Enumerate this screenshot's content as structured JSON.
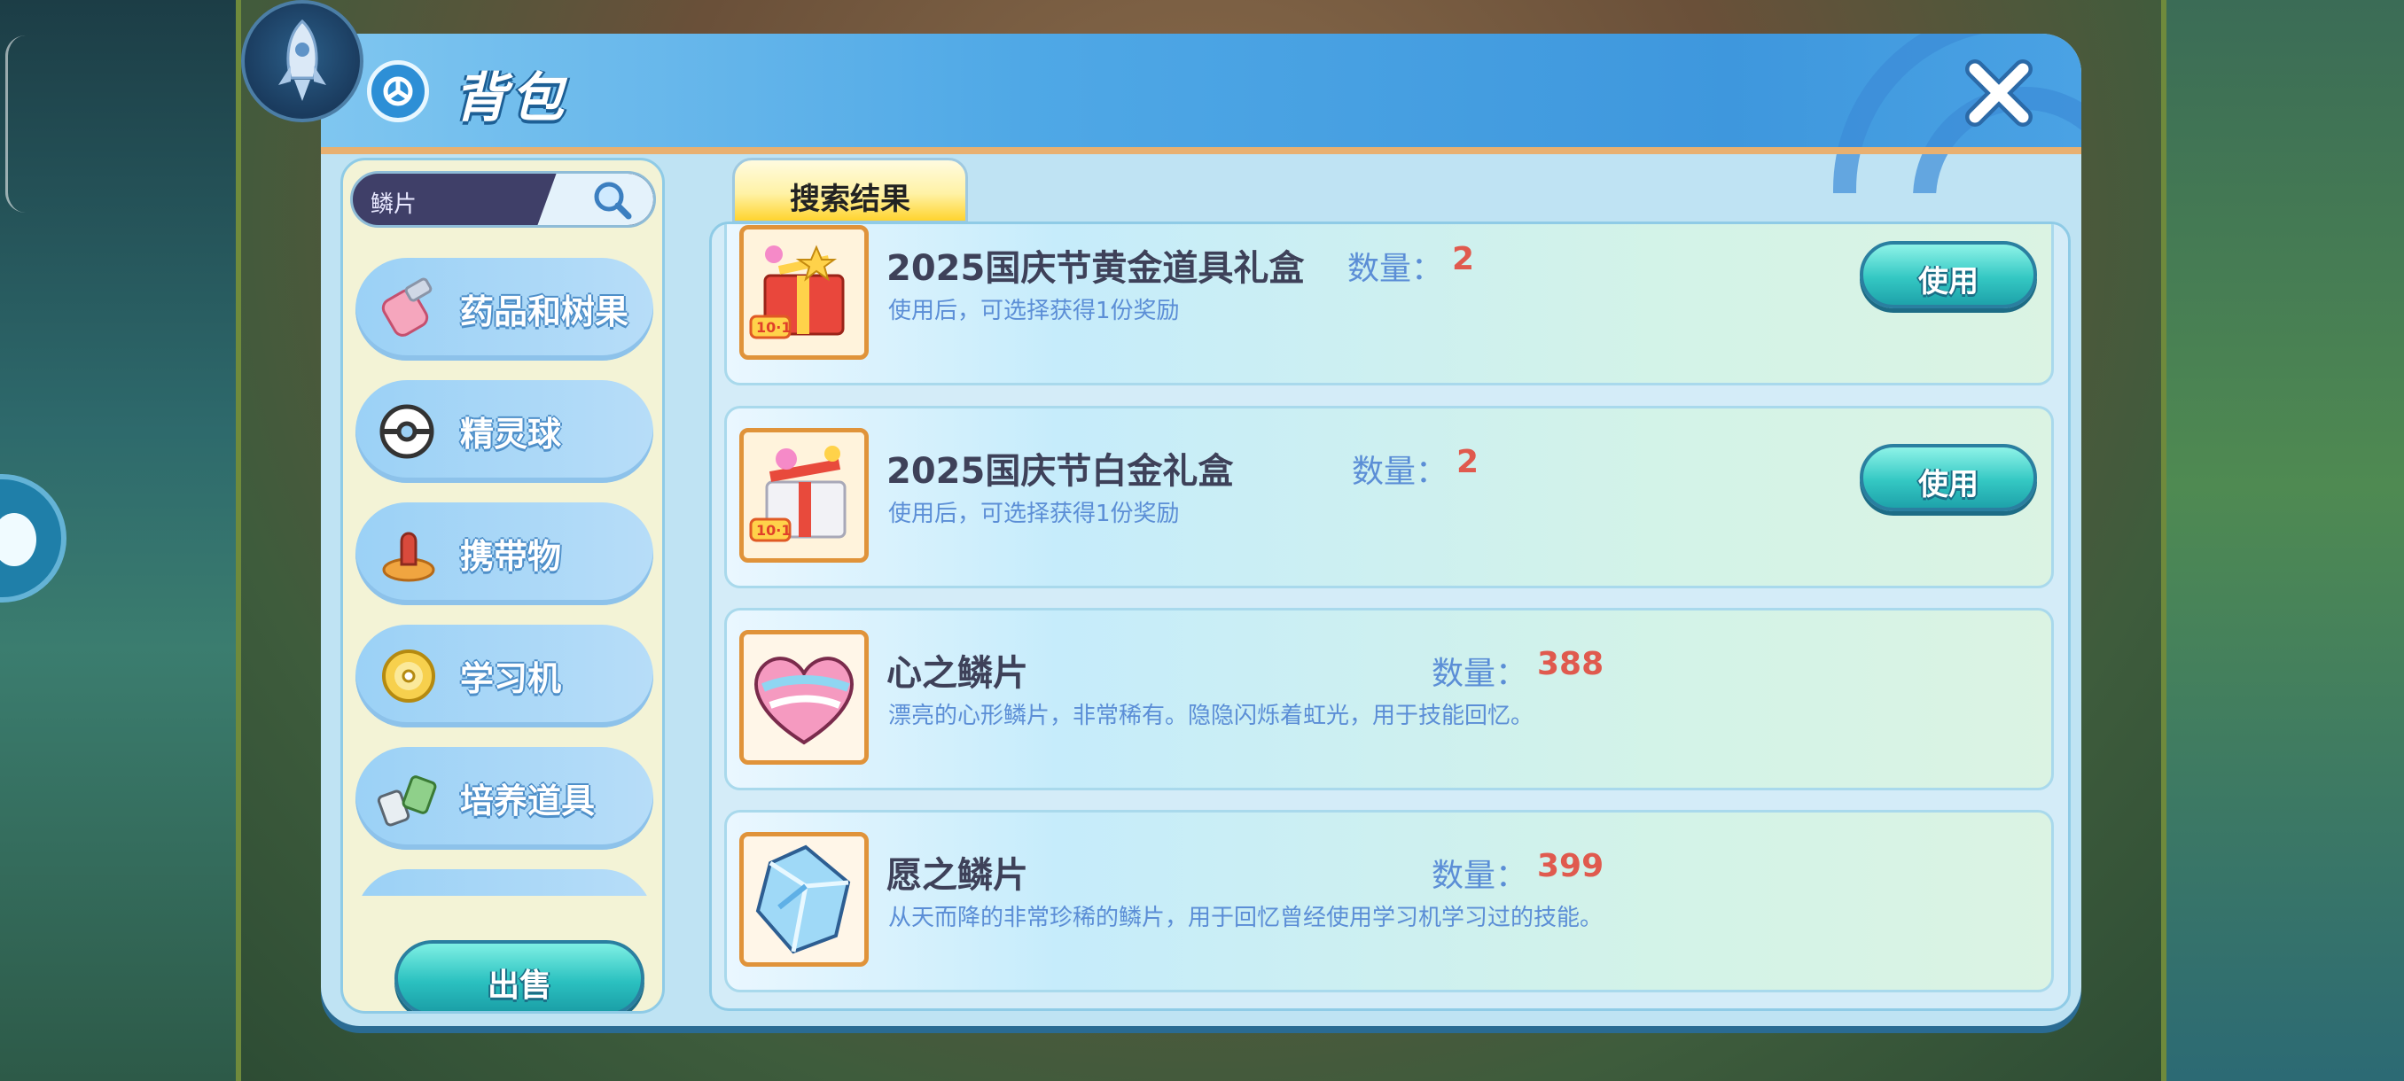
{
  "window": {
    "title": "背包"
  },
  "search": {
    "value": "鳞片"
  },
  "categories": [
    {
      "label": "药品和树果",
      "icon": "potion-icon"
    },
    {
      "label": "精灵球",
      "icon": "pokeball-icon"
    },
    {
      "label": "携带物",
      "icon": "held-item-icon"
    },
    {
      "label": "学习机",
      "icon": "disc-icon"
    },
    {
      "label": "培养道具",
      "icon": "training-item-icon"
    }
  ],
  "sell_label": "出售",
  "tab_label": "搜索结果",
  "items": [
    {
      "name": "2025国庆节黄金道具礼盒",
      "desc": "使用后，可选择获得1份奖励",
      "qty_label": "数量：",
      "qty": "2",
      "action": "使用",
      "icon": "gold-gift-box-icon"
    },
    {
      "name": "2025国庆节白金礼盒",
      "desc": "使用后，可选择获得1份奖励",
      "qty_label": "数量：",
      "qty": "2",
      "action": "使用",
      "icon": "platinum-gift-box-icon"
    },
    {
      "name": "心之鳞片",
      "desc": "漂亮的心形鳞片，非常稀有。隐隐闪烁着虹光，用于技能回忆。",
      "qty_label": "数量：",
      "qty": "388",
      "icon": "heart-scale-icon"
    },
    {
      "name": "愿之鳞片",
      "desc": "从天而降的非常珍稀的鳞片，用于回忆曾经使用学习机学习过的技能。",
      "qty_label": "数量：",
      "qty": "399",
      "icon": "wish-scale-icon"
    }
  ],
  "colors": {
    "accent": "#34c8c3",
    "quantity": "#e05a4e",
    "desc": "#5b8ed6",
    "header": "#4fa8e6"
  }
}
